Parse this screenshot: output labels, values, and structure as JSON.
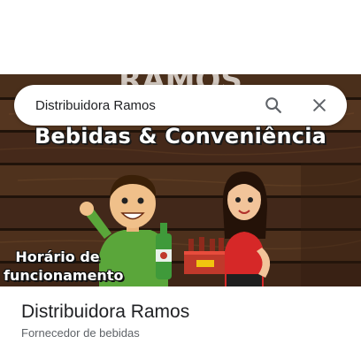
{
  "search": {
    "query": "Distribuidora Ramos",
    "search_icon": "search-icon",
    "close_icon": "close-icon"
  },
  "hero": {
    "banner_title": "Bebidas & Conveniência",
    "hours_label_line1": "Horário de",
    "hours_label_line2": "funcionamento"
  },
  "place": {
    "name": "Distribuidora Ramos",
    "category": "Fornecedor de bebidas"
  },
  "colors": {
    "wood_dark": "#3a2414",
    "text_primary": "#202124",
    "text_secondary": "#5f6368",
    "icon_gray": "#5f6368"
  }
}
